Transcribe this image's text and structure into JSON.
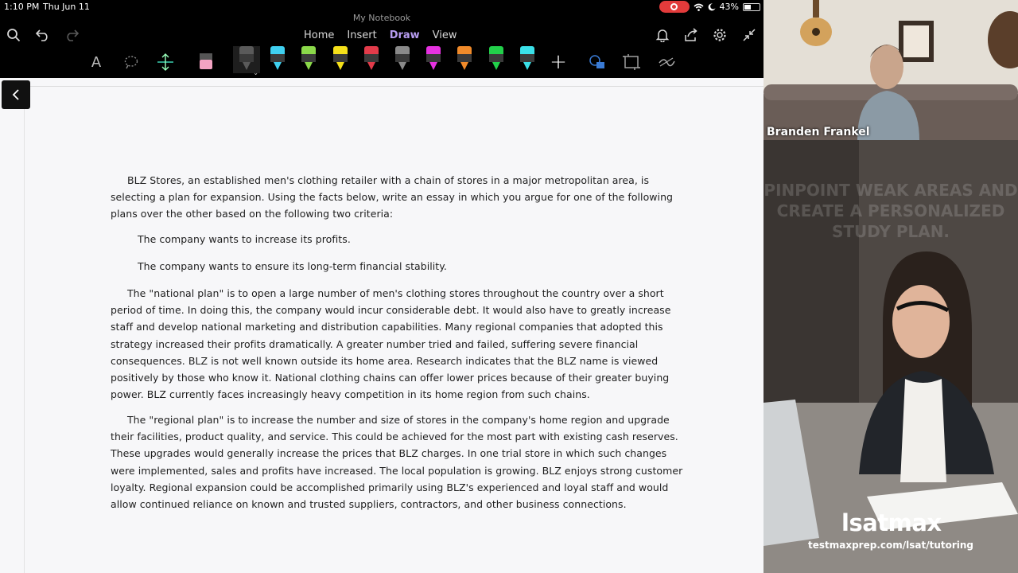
{
  "status": {
    "time": "1:10 PM",
    "date": "Thu Jun 11",
    "battery": "43%",
    "battery_level": 0.43
  },
  "app": {
    "title": "My Notebook",
    "tabs": [
      {
        "label": "Home"
      },
      {
        "label": "Insert"
      },
      {
        "label": "Draw"
      },
      {
        "label": "View"
      }
    ],
    "active_tab": "Draw"
  },
  "toolbar": {
    "text_tool": "A",
    "pen_colors": [
      "#5a5a5a",
      "#3fd0f0",
      "#8bd84a",
      "#f5e01a",
      "#e23b4a",
      "#8a8a8a",
      "#e632e0",
      "#f08a2a",
      "#22d04a",
      "#3ae0e8"
    ],
    "add_label": "+",
    "accent": "#b79cf0"
  },
  "document": {
    "paragraphs": [
      "BLZ Stores, an established men's clothing retailer with a chain of stores in a major metropolitan area, is selecting a plan for expansion. Using the facts below, write an essay in which you argue for one of the following plans over the other based on the following two criteria:",
      "The company wants to increase its profits.",
      "The company wants to ensure its long-term financial stability.",
      "The \"national plan\" is to open a large number of men's clothing stores throughout the country over a short period of time. In doing this, the company would incur considerable debt. It would also have to greatly increase staff and develop national marketing and distribution capabilities. Many regional companies that adopted this strategy increased their profits dramatically. A greater number tried and failed, suffering severe financial consequences. BLZ is not well known outside its home area. Research indicates that the BLZ name is viewed positively by those who know it. National clothing chains can offer lower prices because of their greater buying power. BLZ currently faces increasingly heavy competition in its home region from such chains.",
      "The \"regional plan\" is to increase the number and size of stores in the company's home region and upgrade their facilities, product quality, and service. This could be achieved for the most part with existing cash reserves. These upgrades would generally increase the prices that BLZ charges. In one trial store in which such changes were implemented, sales and profits have increased. The local population is growing. BLZ enjoys strong customer loyalty. Regional expansion could be accomplished primarily using BLZ's experienced and loyal staff and would allow continued reliance on known and trusted suppliers, contractors, and other business connections."
    ]
  },
  "video": {
    "presenter_name": "Branden Frankel",
    "ad_headline": "PINPOINT WEAK AREAS AND CREATE A PERSONALIZED STUDY PLAN.",
    "brand": "lsatmax",
    "url": "testmaxprep.com/lsat/tutoring"
  }
}
